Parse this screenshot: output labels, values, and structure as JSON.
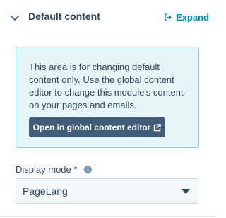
{
  "section": {
    "title": "Default content",
    "expand_label": "Expand"
  },
  "info": {
    "lines": [
      "This area is for changing default",
      "content only. Use the global content",
      "editor to change this module's content",
      "on your pages and emails."
    ],
    "button_label": "Open in global content editor"
  },
  "display_mode": {
    "label": "Display mode *",
    "value": "PageLang"
  },
  "colors": {
    "text": "#33475b",
    "link": "#0091ae",
    "info_bg": "#e5f5f8",
    "info_border": "#7fd1de",
    "button_bg": "#425b76"
  },
  "icons": {
    "section_toggle": "chevron-down-icon",
    "expand": "expand-icon",
    "external": "external-link-icon",
    "help": "info-icon",
    "select_caret": "caret-down-icon"
  }
}
